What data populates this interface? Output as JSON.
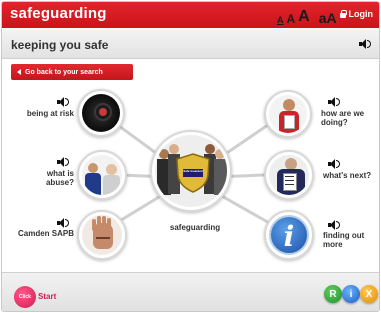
{
  "app": {
    "title": "safeguarding",
    "text_size_options": [
      "A",
      "A",
      "A",
      "aA"
    ],
    "login_label": "Login"
  },
  "page": {
    "title": "keeping you safe",
    "back_label": "Go back to your search"
  },
  "center": {
    "label": "safeguarding",
    "shield_text": "Safe Guarded"
  },
  "topics": {
    "being_at_risk": "being at risk",
    "what_is_abuse_1": "what is",
    "what_is_abuse_2": "abuse?",
    "camden_sapb": "Camden SAPB",
    "how_are_we_1": "how are we",
    "how_are_we_2": "doing?",
    "whats_next": "what's next?",
    "finding_out_1": "finding out",
    "finding_out_2": "more"
  },
  "footer": {
    "clickstart_badge": "Click",
    "clickstart_word": "Start",
    "buttons": [
      "R",
      "i",
      "X"
    ]
  },
  "colors": {
    "brand_red": "#d21a20",
    "accent_pink": "#d21a52",
    "rix_green": "#1f8f2c",
    "rix_blue": "#1a5fc0",
    "rix_orange": "#e28a00"
  }
}
